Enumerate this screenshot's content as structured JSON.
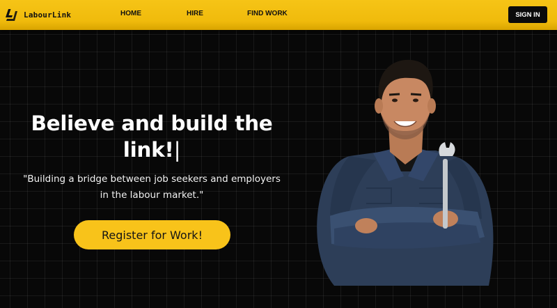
{
  "brand": {
    "name": "LabourLink",
    "logo_icon": "labourlink-logo-icon"
  },
  "nav": {
    "items": [
      {
        "label": "HOME"
      },
      {
        "label": "HIRE"
      },
      {
        "label": "FIND WORK"
      }
    ],
    "signin_label": "SIGN IN"
  },
  "hero": {
    "headline": "Believe and build the link!",
    "cursor": "|",
    "tagline": "\"Building a bridge between job seekers and employers in the labour market.\"",
    "cta_label": "Register for Work!",
    "image": "smiling-worker-with-wrench"
  },
  "colors": {
    "accent": "#f8c31a",
    "navbar": "#f0bb0c",
    "background": "#080808",
    "text": "#ffffff"
  }
}
